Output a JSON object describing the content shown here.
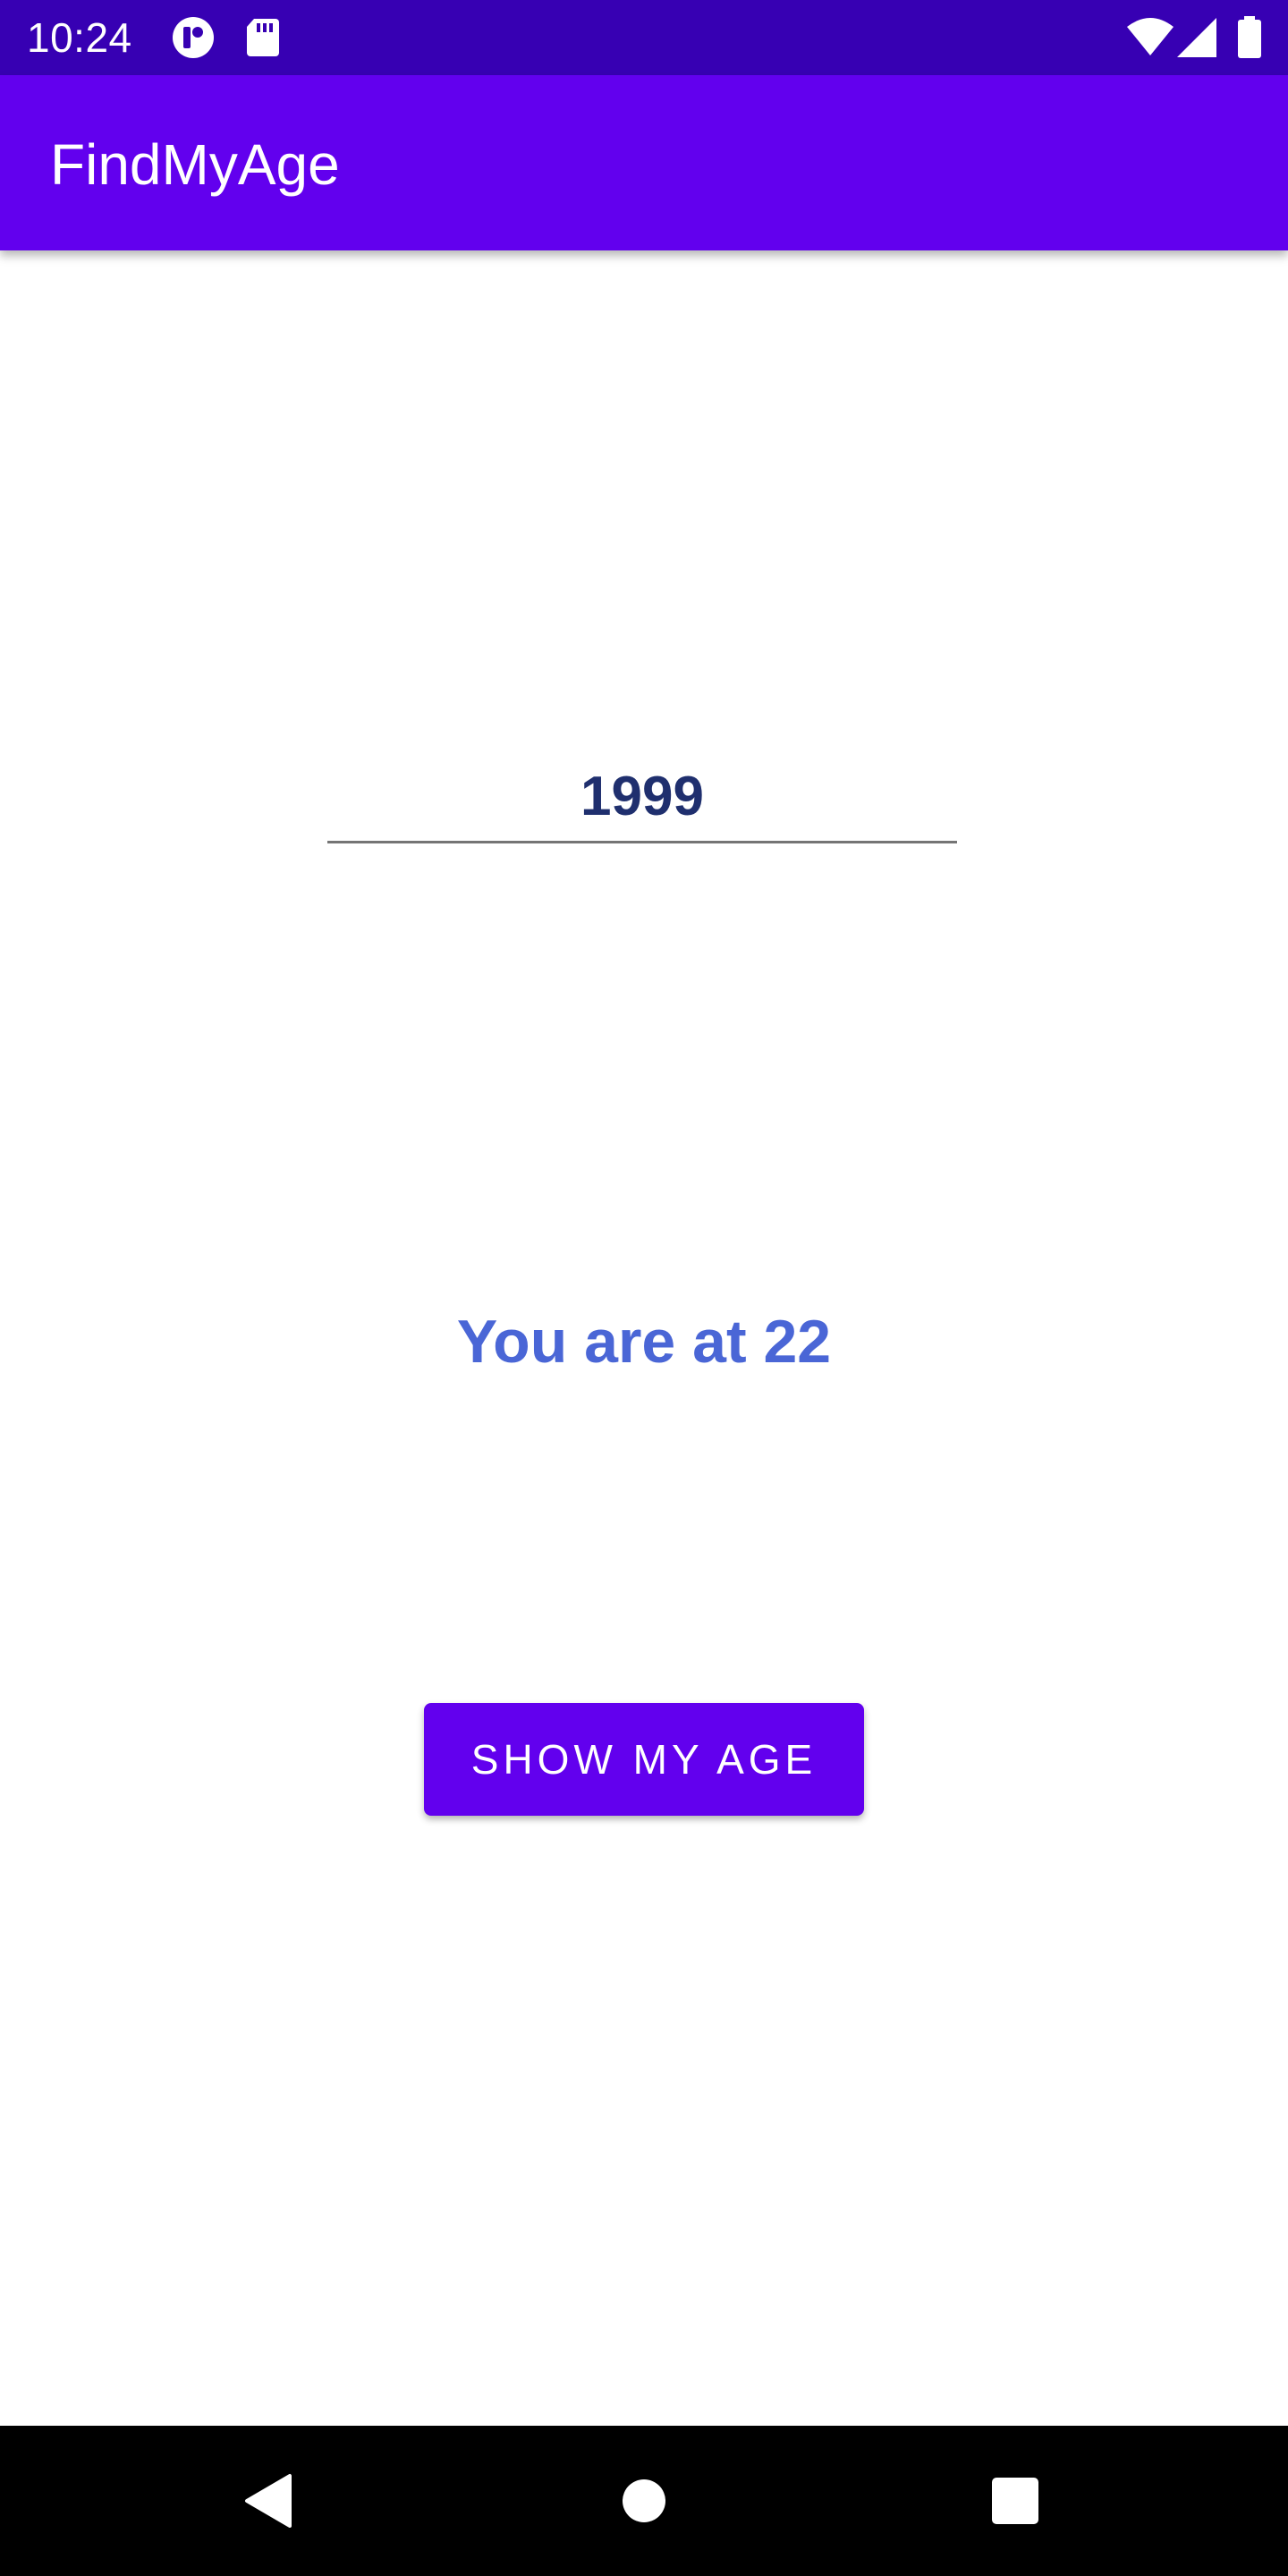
{
  "status_bar": {
    "time": "10:24",
    "icons": [
      "notification-icon",
      "sd-card-icon",
      "wifi-icon",
      "signal-icon",
      "battery-icon"
    ]
  },
  "app_bar": {
    "title": "FindMyAge"
  },
  "form": {
    "year_value": "1999",
    "result": "You are at 22",
    "button_label": "SHOW MY AGE"
  },
  "colors": {
    "status_bar": "#3700b3",
    "primary": "#6200ee",
    "year_text": "#1f2f6e",
    "result_text": "#4a66d6",
    "nav_bar": "#000000"
  },
  "nav_bar": {
    "buttons": [
      "back-icon",
      "home-icon",
      "recents-icon"
    ]
  }
}
